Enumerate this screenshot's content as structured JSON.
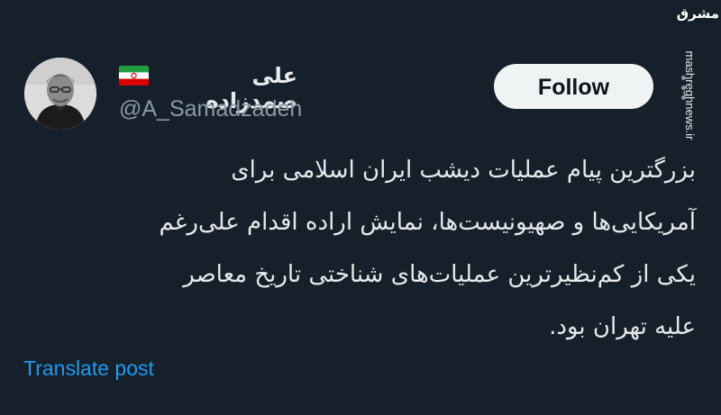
{
  "tweet": {
    "author": {
      "display_name": "علی صمدزاده",
      "handle": "@A_Samadzadeh",
      "flag": "iran-flag"
    },
    "follow_label": "Follow",
    "more_icon": "more-icon",
    "text_lines": [
      "بزرگترین پیام عملیات دیشب ایران اسلامی برای",
      "آمریکایی‌ها و صهیونیست‌ها، نمایش اراده اقدام علی‌رغم",
      "یکی از کم‌نظیرترین عملیات‌های شناختی تاریخ معاصر",
      "علیه تهران بود."
    ],
    "translate_label": "Translate post"
  },
  "watermark": {
    "logo": "مشرق",
    "url": "mashreghnews.ir"
  },
  "colors": {
    "background": "#15202b",
    "text": "#e7e9ea",
    "muted": "#8b98a5",
    "link": "#1d9bf0",
    "follow_bg": "#eff3f4"
  }
}
